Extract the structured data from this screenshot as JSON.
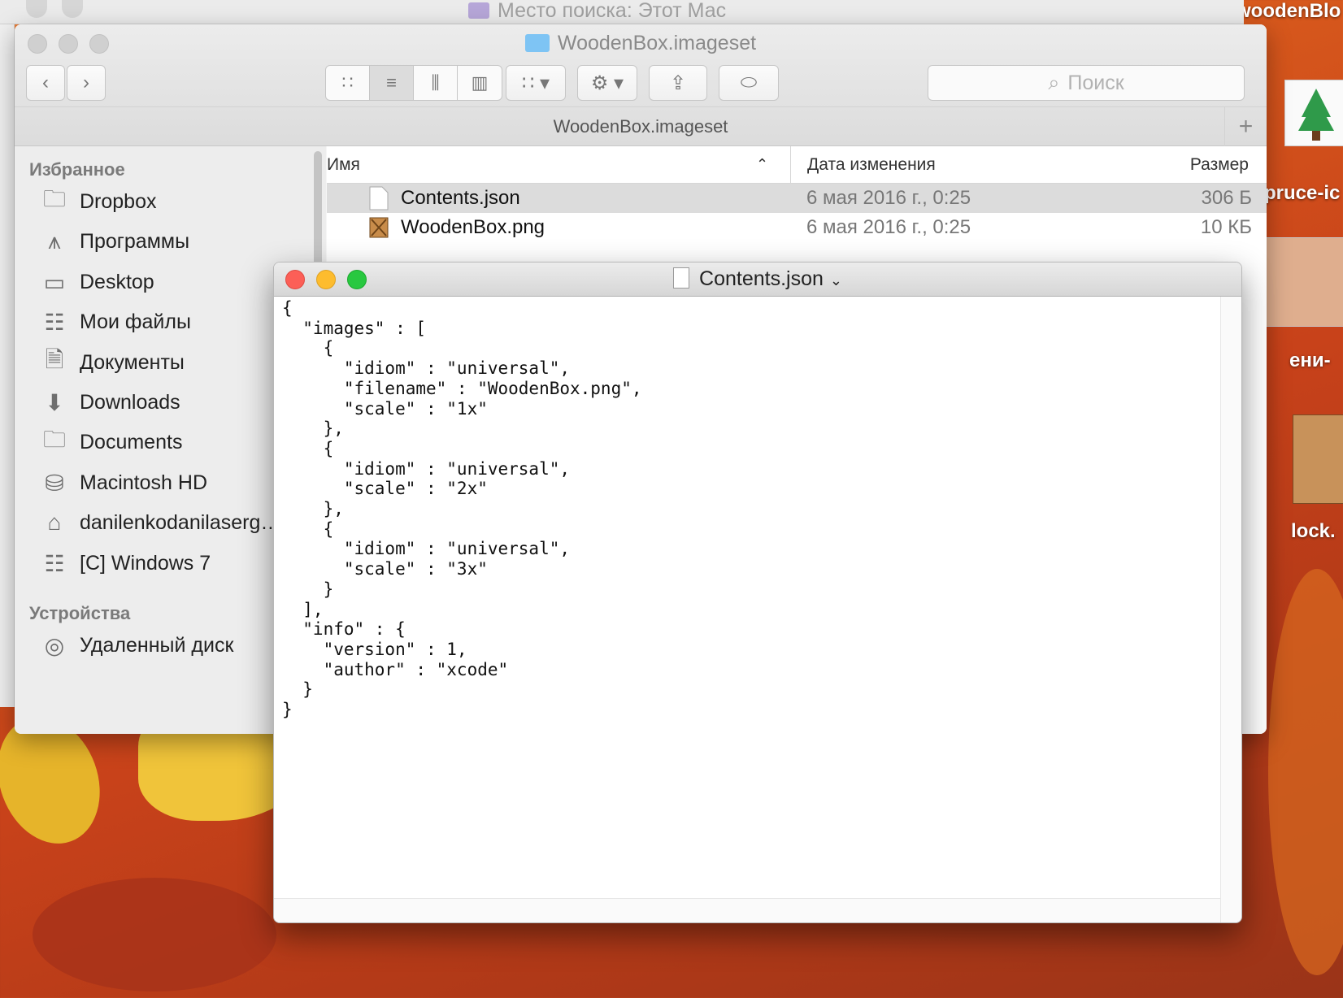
{
  "back_window": {
    "title": "Место поиска: Этот Мас"
  },
  "desktop": {
    "labels": [
      "woodenBlo",
      "pruce-ic",
      "ени-",
      "lock."
    ]
  },
  "finder": {
    "title": "WoodenBox.imageset",
    "path_title": "WoodenBox.imageset",
    "search_placeholder": "Поиск",
    "sidebar": {
      "favorites_label": "Избранное",
      "favorites": [
        {
          "label": "Dropbox",
          "icon": "folder-icon"
        },
        {
          "label": "Программы",
          "icon": "applications-icon"
        },
        {
          "label": "Desktop",
          "icon": "desktop-icon"
        },
        {
          "label": "Мои файлы",
          "icon": "all-files-icon"
        },
        {
          "label": "Документы",
          "icon": "documents-icon"
        },
        {
          "label": "Downloads",
          "icon": "downloads-icon"
        },
        {
          "label": "Documents",
          "icon": "folder-icon"
        },
        {
          "label": "Macintosh HD",
          "icon": "hard-drive-icon"
        },
        {
          "label": "danilenkodanilaserg…",
          "icon": "home-icon"
        },
        {
          "label": "[C] Windows 7",
          "icon": "network-drive-icon"
        }
      ],
      "devices_label": "Устройства",
      "devices": [
        {
          "label": "Удаленный диск",
          "icon": "disc-icon"
        }
      ]
    },
    "columns": {
      "name": "Имя",
      "date": "Дата изменения",
      "size": "Размер"
    },
    "files": [
      {
        "name": "Contents.json",
        "date": "6 мая 2016 г., 0:25",
        "size": "306 Б",
        "selected": true
      },
      {
        "name": "WoodenBox.png",
        "date": "6 мая 2016 г., 0:25",
        "size": "10 КБ",
        "selected": false
      }
    ]
  },
  "editor": {
    "title": "Contents.json",
    "content": "{\n  \"images\" : [\n    {\n      \"idiom\" : \"universal\",\n      \"filename\" : \"WoodenBox.png\",\n      \"scale\" : \"1x\"\n    },\n    {\n      \"idiom\" : \"universal\",\n      \"scale\" : \"2x\"\n    },\n    {\n      \"idiom\" : \"universal\",\n      \"scale\" : \"3x\"\n    }\n  ],\n  \"info\" : {\n    \"version\" : 1,\n    \"author\" : \"xcode\"\n  }\n}"
  }
}
